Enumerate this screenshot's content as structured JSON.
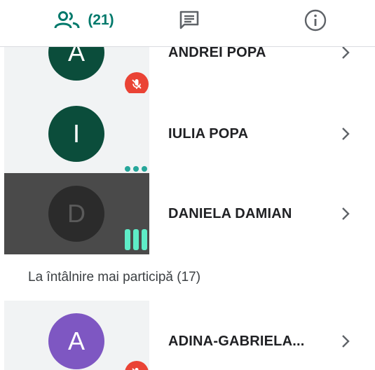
{
  "tabs": {
    "people_count": "(21)",
    "people_icon": "people-icon",
    "chat_icon": "chat-icon",
    "info_icon": "info-icon"
  },
  "participants": [
    {
      "initial": "A",
      "name": "ANDREI POPA",
      "avatar_color": "#0b4d3b",
      "status": "muted"
    },
    {
      "initial": "I",
      "name": "IULIA POPA",
      "avatar_color": "#0b4d3b",
      "status": "typing"
    },
    {
      "initial": "D",
      "name": "DANIELA DAMIAN",
      "avatar_color": "#2b2b2b",
      "status": "speaking"
    }
  ],
  "section_label": "La întâlnire mai participă (17)",
  "others": [
    {
      "initial": "A",
      "name": "ADINA-GABRIELA...",
      "avatar_color": "#7e57c2",
      "status": "muted"
    }
  ],
  "colors": {
    "accent": "#00796b",
    "muted_badge": "#ea4335",
    "speaking_bars": "#5eecc7"
  }
}
